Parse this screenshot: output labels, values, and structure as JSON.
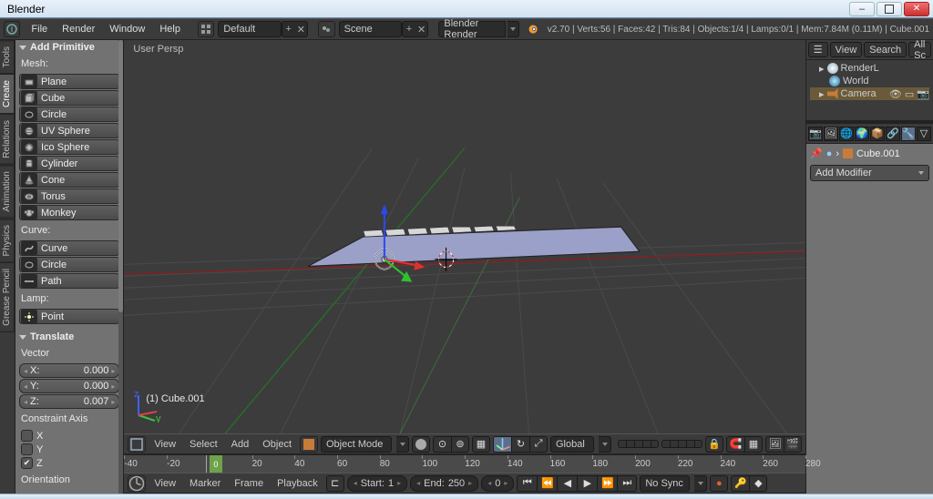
{
  "window": {
    "title": "Blender"
  },
  "header": {
    "menus": [
      "File",
      "Render",
      "Window",
      "Help"
    ],
    "layout": "Default",
    "scene": "Scene",
    "engine": "Blender Render",
    "status": "v2.70 | Verts:56 | Faces:42 | Tris:84 | Objects:1/4 | Lamps:0/1 | Mem:7.84M (0.11M) | Cube.001"
  },
  "lefttabs": [
    "Tools",
    "Create",
    "Relations",
    "Animation",
    "Physics",
    "Grease Pencil"
  ],
  "toolshelf": {
    "add_primitive": "Add Primitive",
    "mesh_label": "Mesh:",
    "mesh": [
      "Plane",
      "Cube",
      "Circle",
      "UV Sphere",
      "Ico Sphere",
      "Cylinder",
      "Cone",
      "Torus",
      "Monkey"
    ],
    "curve_label": "Curve:",
    "curve": [
      "Curve",
      "Circle",
      "Path"
    ],
    "lamp_label": "Lamp:",
    "lamp": [
      "Point"
    ],
    "translate_header": "Translate",
    "vector_label": "Vector",
    "vec": {
      "x_lbl": "X:",
      "x_val": "0.000",
      "y_lbl": "Y:",
      "y_val": "0.000",
      "z_lbl": "Z:",
      "z_val": "0.007"
    },
    "constraint_label": "Constraint Axis",
    "axes": {
      "x": "X",
      "y": "Y",
      "z": "Z"
    },
    "orientation_label": "Orientation"
  },
  "viewport": {
    "persp": "User Persp",
    "object_line": "(1) Cube.001",
    "header_menus": [
      "View",
      "Select",
      "Add",
      "Object"
    ],
    "mode": "Object Mode",
    "orient": "Global"
  },
  "timeline": {
    "ticks": [
      -40,
      -20,
      0,
      20,
      40,
      60,
      80,
      100,
      120,
      140,
      160,
      180,
      200,
      220,
      240,
      260,
      280
    ],
    "current": 0,
    "header_menus": [
      "View",
      "Marker",
      "Frame",
      "Playback"
    ],
    "start_lbl": "Start:",
    "start_val": "1",
    "end_lbl": "End:",
    "end_val": "250",
    "frame_val": "0",
    "sync": "No Sync"
  },
  "right": {
    "hdr": {
      "view": "View",
      "search": "Search",
      "all": "All Sc"
    },
    "outliner": [
      {
        "name": "RenderL",
        "icon": "scene"
      },
      {
        "name": "World",
        "icon": "world"
      },
      {
        "name": "Camera",
        "icon": "camera",
        "sel": true
      }
    ],
    "active_obj": "Cube.001",
    "add_modifier": "Add Modifier"
  }
}
